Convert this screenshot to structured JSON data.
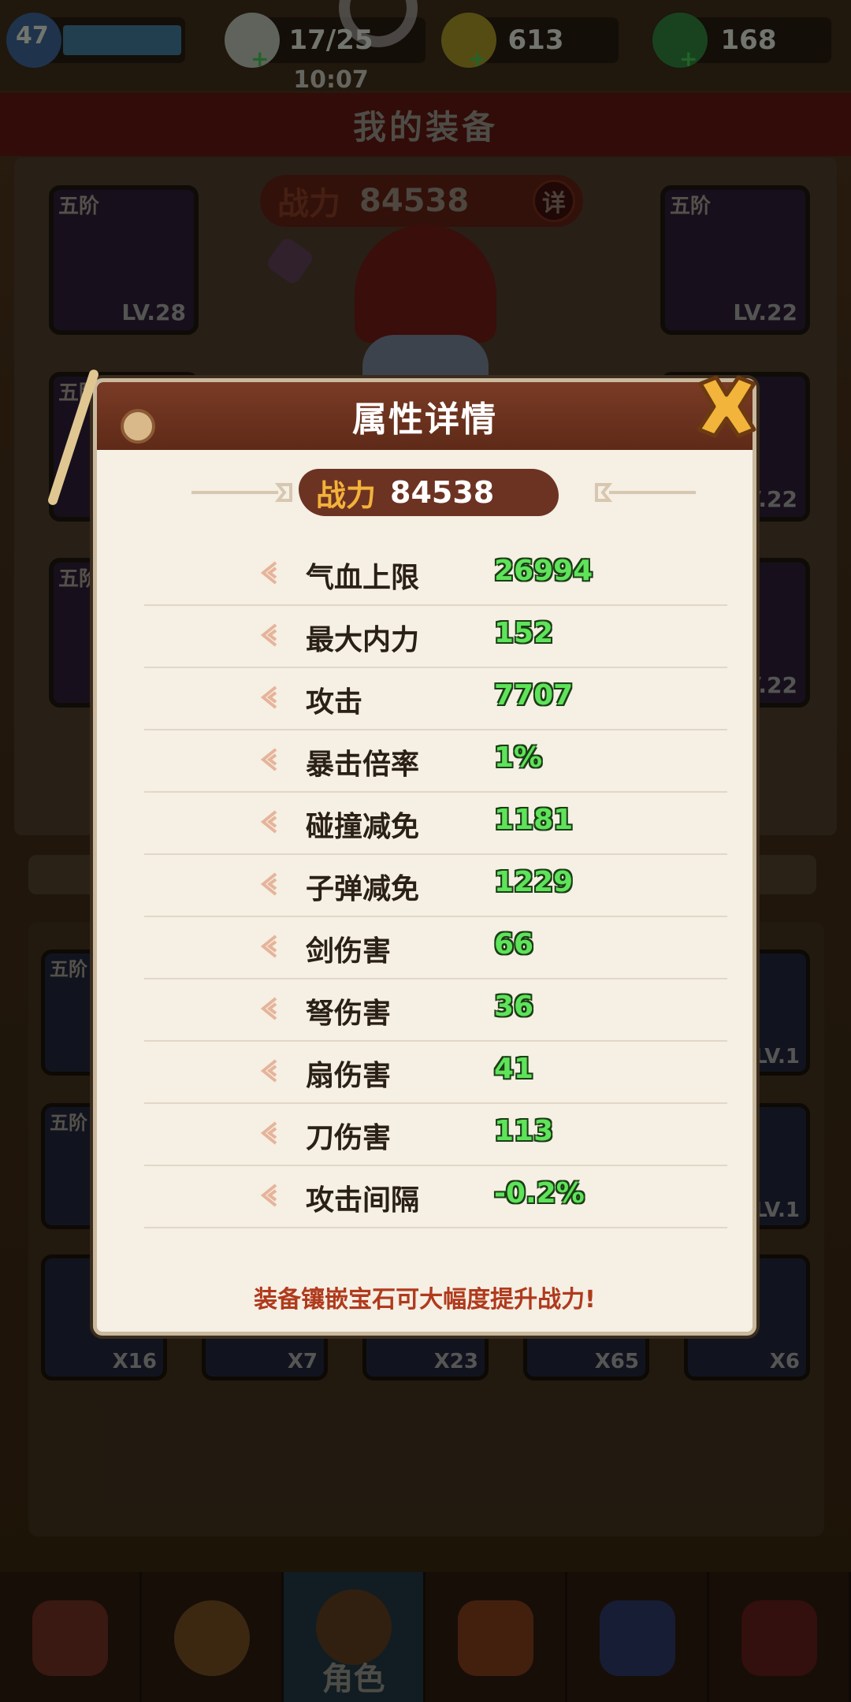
{
  "resources": {
    "level": "47",
    "stamina": "17/25",
    "gold": "613",
    "jade": "168",
    "clock": "10:07"
  },
  "screen_title": "我的装备",
  "equipment_power": {
    "label": "战力",
    "value": "84538",
    "detail_label": "详"
  },
  "equip_slots": [
    {
      "tier": "五阶",
      "level": "LV.28"
    },
    {
      "tier": "五阶",
      "level": "LV.22"
    },
    {
      "tier": "五阶",
      "level": ""
    },
    {
      "tier": "",
      "level": "LV.22"
    },
    {
      "tier": "五阶",
      "level": ""
    },
    {
      "tier": "",
      "level": "LV.22"
    }
  ],
  "bag_items": [
    {
      "tier": "五阶",
      "count": ""
    },
    {
      "tier": "",
      "count": "LV.1"
    },
    {
      "tier": "五阶",
      "count": ""
    },
    {
      "tier": "",
      "count": "LV.1"
    },
    {
      "tier": "",
      "count": "X16"
    },
    {
      "tier": "",
      "count": "X7"
    },
    {
      "tier": "",
      "count": "X23"
    },
    {
      "tier": "",
      "count": "X65"
    },
    {
      "tier": "",
      "count": "X6"
    }
  ],
  "bottom_nav": [
    {
      "label": "",
      "icon": "scroll-icon"
    },
    {
      "label": "",
      "icon": "bag-icon"
    },
    {
      "label": "角色",
      "icon": "character-icon"
    },
    {
      "label": "",
      "icon": "pet-icon"
    },
    {
      "label": "",
      "icon": "book-icon"
    },
    {
      "label": "",
      "icon": "gate-icon"
    }
  ],
  "modal": {
    "title": "属性详情",
    "power_label": "战力",
    "power_value": "84538",
    "stats": [
      {
        "name": "气血上限",
        "value": "26994"
      },
      {
        "name": "最大内力",
        "value": "152"
      },
      {
        "name": "攻击",
        "value": "7707"
      },
      {
        "name": "暴击倍率",
        "value": "1%"
      },
      {
        "name": "碰撞减免",
        "value": "1181"
      },
      {
        "name": "子弹减免",
        "value": "1229"
      },
      {
        "name": "剑伤害",
        "value": "66"
      },
      {
        "name": "弩伤害",
        "value": "36"
      },
      {
        "name": "扇伤害",
        "value": "41"
      },
      {
        "name": "刀伤害",
        "value": "113"
      },
      {
        "name": "攻击间隔",
        "value": "-0.2%"
      }
    ],
    "tip": "装备镶嵌宝石可大幅度提升战力!"
  },
  "colors": {
    "stat_value": "#5ee35a",
    "tip_text": "#b03a1d",
    "modal_header": "#6d3322",
    "power_label": "#f3b23a"
  }
}
